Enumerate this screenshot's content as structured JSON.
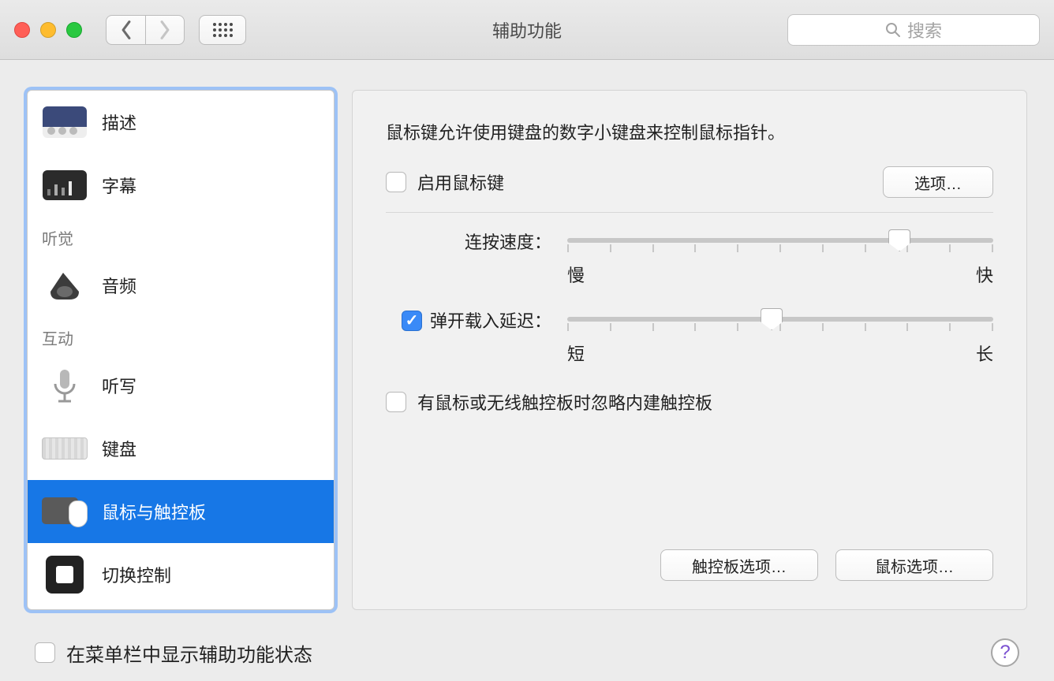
{
  "window": {
    "title": "辅助功能"
  },
  "search": {
    "placeholder": "搜索"
  },
  "sidebar": {
    "items": [
      {
        "label": "描述"
      },
      {
        "label": "字幕"
      }
    ],
    "section_hearing": "听觉",
    "items2": [
      {
        "label": "音频"
      }
    ],
    "section_interact": "互动",
    "items3": [
      {
        "label": "听写"
      },
      {
        "label": "键盘"
      },
      {
        "label": "鼠标与触控板"
      },
      {
        "label": "切换控制"
      }
    ]
  },
  "main": {
    "intro": "鼠标键允许使用键盘的数字小键盘来控制鼠标指针。",
    "enable_label": "启用鼠标键",
    "options_btn": "选项…",
    "slider1": {
      "label": "连按速度：",
      "low": "慢",
      "high": "快",
      "value_pct": 78
    },
    "spring_label": "弹开载入延迟：",
    "slider2": {
      "low": "短",
      "high": "长",
      "value_pct": 48
    },
    "ignore_label": "有鼠标或无线触控板时忽略内建触控板",
    "trackpad_btn": "触控板选项…",
    "mouse_btn": "鼠标选项…"
  },
  "footer": {
    "showstatus_label": "在菜单栏中显示辅助功能状态"
  }
}
